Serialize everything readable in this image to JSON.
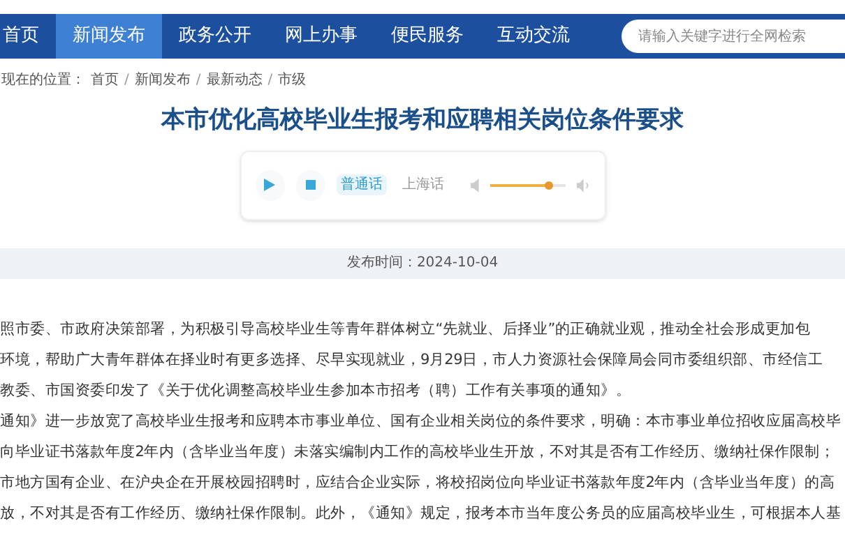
{
  "nav": {
    "items": [
      {
        "label": "首页",
        "selected": false
      },
      {
        "label": "新闻发布",
        "selected": true
      },
      {
        "label": "政务公开",
        "selected": false
      },
      {
        "label": "网上办事",
        "selected": false
      },
      {
        "label": "便民服务",
        "selected": false
      },
      {
        "label": "互动交流",
        "selected": false
      }
    ],
    "search": {
      "placeholder": "请输入关键字进行全网检索"
    }
  },
  "breadcrumb": {
    "label": "现在的位置：",
    "separator": "/",
    "items": [
      "首页",
      "新闻发布",
      "最新动态",
      "市级"
    ]
  },
  "article": {
    "title": "本市优化高校毕业生报考和应聘相关岗位条件要求",
    "player": {
      "dialects": [
        {
          "label": "普通话",
          "selected": true
        },
        {
          "label": "上海话",
          "selected": false
        }
      ],
      "volume": {
        "level": 0.78
      }
    },
    "date": "发布时间：2024-10-04",
    "lines": [
      "照市委、市政府决策部署，为积极引导高校毕业生等青年群体树立“先就业、后择业”的正确就业观，推动全社会形成更加包",
      "环境，帮助广大青年群体在择业时有更多选择、尽早实现就业，9月29日，市人力资源社会保障局会同市委组织部、市经信工",
      "教委、市国资委印发了《关于优化调整高校毕业生参加本市招考（聘）工作有关事项的通知》。",
      "通知》进一步放宽了高校毕业生报考和应聘本市事业单位、国有企业相关岗位的条件要求，明确：本市事业单位招收应届高校毕",
      "向毕业证书落款年度2年内（含毕业当年度）未落实编制内工作的高校毕业生开放，不对其是否有工作经历、缴纳社保作限制；",
      "市地方国有企业、在沪央企在开展校园招聘时，应结合企业实际，将校招岗位向毕业证书落款年度2年内（含毕业当年度）的高",
      "放，不对其是否有工作经历、缴纳社保作限制。此外，《通知》规定，报考本市当年度公务员的应届高校毕业生，可根据本人基"
    ]
  }
}
